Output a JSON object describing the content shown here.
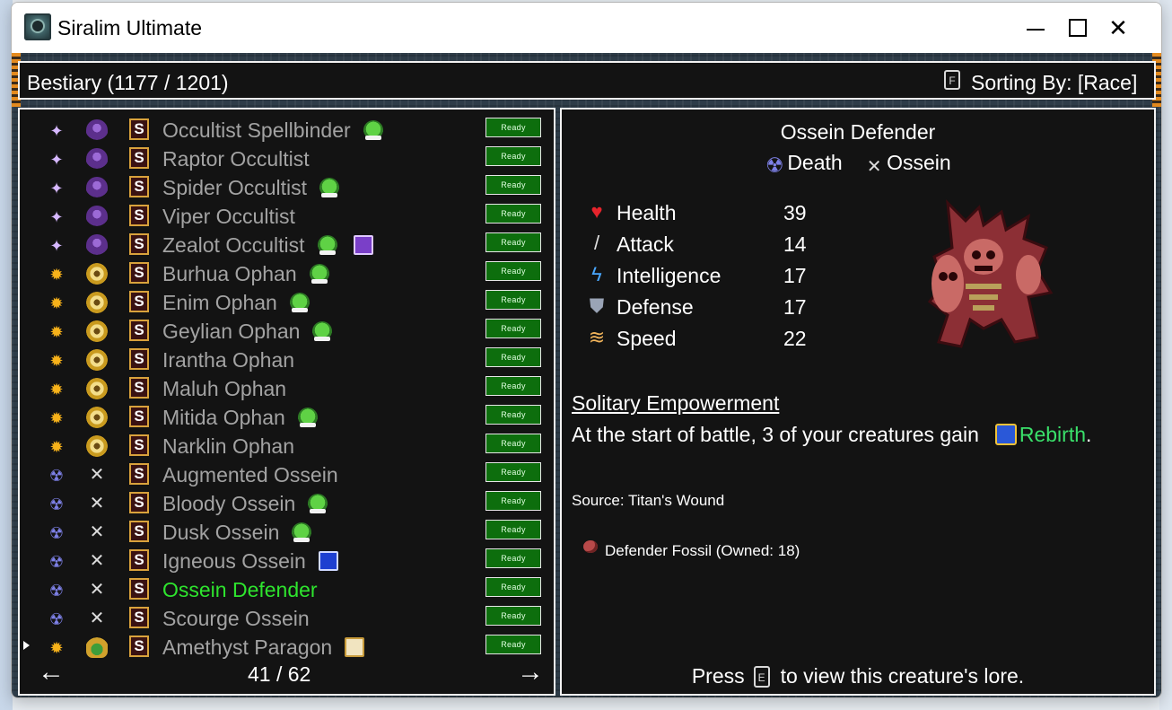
{
  "window": {
    "title": "Siralim Ultimate",
    "controls": [
      "minimize",
      "maximize",
      "close"
    ]
  },
  "header": {
    "title": "Bestiary (1177 / 1201)",
    "sort_key": "F",
    "sort_label": "Sorting By: [Race]"
  },
  "list": {
    "ready_label": "Ready",
    "rows": [
      {
        "name": "Occultist Spellbinder",
        "class_icon": "sparkle-icon",
        "race_icon": "occultist-race-icon",
        "extra": "goblin-icon",
        "selected": false
      },
      {
        "name": "Raptor Occultist",
        "class_icon": "sparkle-icon",
        "race_icon": "occultist-race-icon",
        "extra": "",
        "selected": false
      },
      {
        "name": "Spider Occultist",
        "class_icon": "sparkle-icon",
        "race_icon": "occultist-race-icon",
        "extra": "goblin-icon",
        "selected": false
      },
      {
        "name": "Viper Occultist",
        "class_icon": "sparkle-icon",
        "race_icon": "occultist-race-icon",
        "extra": "",
        "selected": false
      },
      {
        "name": "Zealot Occultist",
        "class_icon": "sparkle-icon",
        "race_icon": "occultist-race-icon",
        "extra": "goblin-icon,purple-card-icon",
        "selected": false
      },
      {
        "name": "Burhua Ophan",
        "class_icon": "sun-icon",
        "race_icon": "ophan-race-icon",
        "extra": "goblin-icon",
        "selected": false
      },
      {
        "name": "Enim Ophan",
        "class_icon": "sun-icon",
        "race_icon": "ophan-race-icon",
        "extra": "goblin-icon",
        "selected": false
      },
      {
        "name": "Geylian Ophan",
        "class_icon": "sun-icon",
        "race_icon": "ophan-race-icon",
        "extra": "goblin-icon",
        "selected": false
      },
      {
        "name": "Irantha Ophan",
        "class_icon": "sun-icon",
        "race_icon": "ophan-race-icon",
        "extra": "",
        "selected": false
      },
      {
        "name": "Maluh Ophan",
        "class_icon": "sun-icon",
        "race_icon": "ophan-race-icon",
        "extra": "",
        "selected": false
      },
      {
        "name": "Mitida Ophan",
        "class_icon": "sun-icon",
        "race_icon": "ophan-race-icon",
        "extra": "goblin-icon",
        "selected": false
      },
      {
        "name": "Narklin Ophan",
        "class_icon": "sun-icon",
        "race_icon": "ophan-race-icon",
        "extra": "",
        "selected": false
      },
      {
        "name": "Augmented Ossein",
        "class_icon": "death-icon",
        "race_icon": "ossein-race-icon",
        "extra": "",
        "selected": false
      },
      {
        "name": "Bloody Ossein",
        "class_icon": "death-icon",
        "race_icon": "ossein-race-icon",
        "extra": "goblin-icon",
        "selected": false
      },
      {
        "name": "Dusk Ossein",
        "class_icon": "death-icon",
        "race_icon": "ossein-race-icon",
        "extra": "goblin-icon",
        "selected": false
      },
      {
        "name": "Igneous Ossein",
        "class_icon": "death-icon",
        "race_icon": "ossein-race-icon",
        "extra": "blue-card-icon",
        "selected": false
      },
      {
        "name": "Ossein Defender",
        "class_icon": "death-icon",
        "race_icon": "ossein-race-icon",
        "extra": "",
        "selected": true
      },
      {
        "name": "Scourge Ossein",
        "class_icon": "death-icon",
        "race_icon": "ossein-race-icon",
        "extra": "",
        "selected": false
      },
      {
        "name": "Amethyst Paragon",
        "class_icon": "sun-icon",
        "race_icon": "paragon-race-icon",
        "extra": "gold-card-icon",
        "selected": false
      }
    ],
    "page": "41 / 62"
  },
  "detail": {
    "name": "Ossein Defender",
    "class": "Death",
    "race": "Ossein",
    "stats": [
      {
        "label": "Health",
        "value": "39",
        "icon": "heart-icon"
      },
      {
        "label": "Attack",
        "value": "14",
        "icon": "sword-icon"
      },
      {
        "label": "Intelligence",
        "value": "17",
        "icon": "lightning-icon"
      },
      {
        "label": "Defense",
        "value": "17",
        "icon": "shield-icon"
      },
      {
        "label": "Speed",
        "value": "22",
        "icon": "wing-icon"
      }
    ],
    "trait_name": "Solitary Empowerment",
    "trait_desc": "At the start of battle, 3 of your creatures gain",
    "trait_buff": "Rebirth",
    "trait_end": ".",
    "source": "Source: Titan's Wound",
    "material": "Defender Fossil (Owned: 18)",
    "lore_prefix": "Press",
    "lore_key": "E",
    "lore_suffix": "to view this creature's lore."
  },
  "colors": {
    "selected": "#2ee42e",
    "list_text": "#a3a3a3",
    "ready_bg": "#0d6e0d",
    "panel_bg": "#131313"
  }
}
